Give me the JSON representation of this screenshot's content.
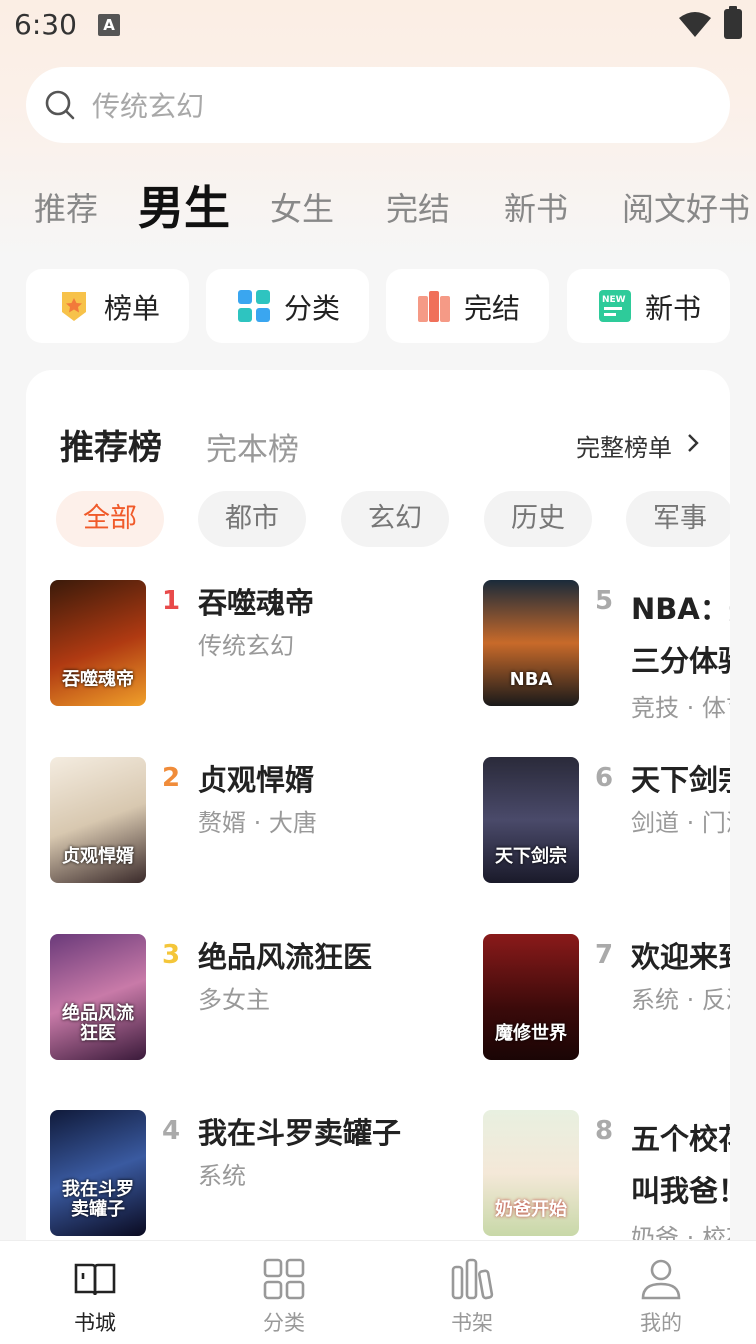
{
  "status_bar": {
    "time": "6:30",
    "notification_letter": "A"
  },
  "search": {
    "placeholder": "传统玄幻"
  },
  "main_tabs": [
    {
      "label": "推荐",
      "active": false
    },
    {
      "label": "男生",
      "active": true
    },
    {
      "label": "女生",
      "active": false
    },
    {
      "label": "完结",
      "active": false
    },
    {
      "label": "新书",
      "active": false
    },
    {
      "label": "阅文好书",
      "active": false
    }
  ],
  "quick_entries": [
    {
      "label": "榜单",
      "icon": "ranking-icon"
    },
    {
      "label": "分类",
      "icon": "category-grid-icon"
    },
    {
      "label": "完结",
      "icon": "completed-books-icon"
    },
    {
      "label": "新书",
      "icon": "new-book-icon"
    }
  ],
  "ranking": {
    "tab_active": "推荐榜",
    "tab_other": "完本榜",
    "full_list_label": "完整榜单",
    "chips": [
      "全部",
      "都市",
      "玄幻",
      "历史",
      "军事"
    ],
    "books": [
      {
        "rank": "1",
        "title": "吞噬魂帝",
        "tags": "传统玄幻",
        "cover_text": "吞噬魂帝",
        "rank_color": "#e84a4a"
      },
      {
        "rank": "2",
        "title": "贞观悍婿",
        "tags": "赘婿 · 大唐",
        "cover_text": "贞观悍婿",
        "rank_color": "#f08c3a"
      },
      {
        "rank": "3",
        "title": "绝品风流狂医",
        "tags": "多女主",
        "cover_text": "绝品风流狂医",
        "rank_color": "#f4c63a"
      },
      {
        "rank": "4",
        "title": "我在斗罗卖罐子",
        "tags": "系统",
        "cover_text": "我在斗罗卖罐子",
        "rank_color": "#aaaaaa"
      },
      {
        "rank": "5",
        "title": "NBA：开",
        "title_line2": "三分体验",
        "tags": "竞技 · 体育",
        "cover_text": "NBA",
        "rank_color": "#aaaaaa"
      },
      {
        "rank": "6",
        "title": "天下剑宗",
        "tags": "剑道 · 门派",
        "cover_text": "天下剑宗",
        "rank_color": "#aaaaaa"
      },
      {
        "rank": "7",
        "title": "欢迎来到",
        "tags": "系统 · 反派",
        "cover_text": "魔修世界",
        "rank_color": "#aaaaaa"
      },
      {
        "rank": "8",
        "title": "五个校花",
        "title_line2": "叫我爸！",
        "tags": "奶爸 · 校花",
        "cover_text": "奶爸开始",
        "rank_color": "#aaaaaa"
      }
    ]
  },
  "bottom_nav": [
    {
      "label": "书城",
      "icon": "book-open-icon",
      "active": true
    },
    {
      "label": "分类",
      "icon": "grid-icon",
      "active": false
    },
    {
      "label": "书架",
      "icon": "bookshelf-icon",
      "active": false
    },
    {
      "label": "我的",
      "icon": "user-icon",
      "active": false
    }
  ]
}
